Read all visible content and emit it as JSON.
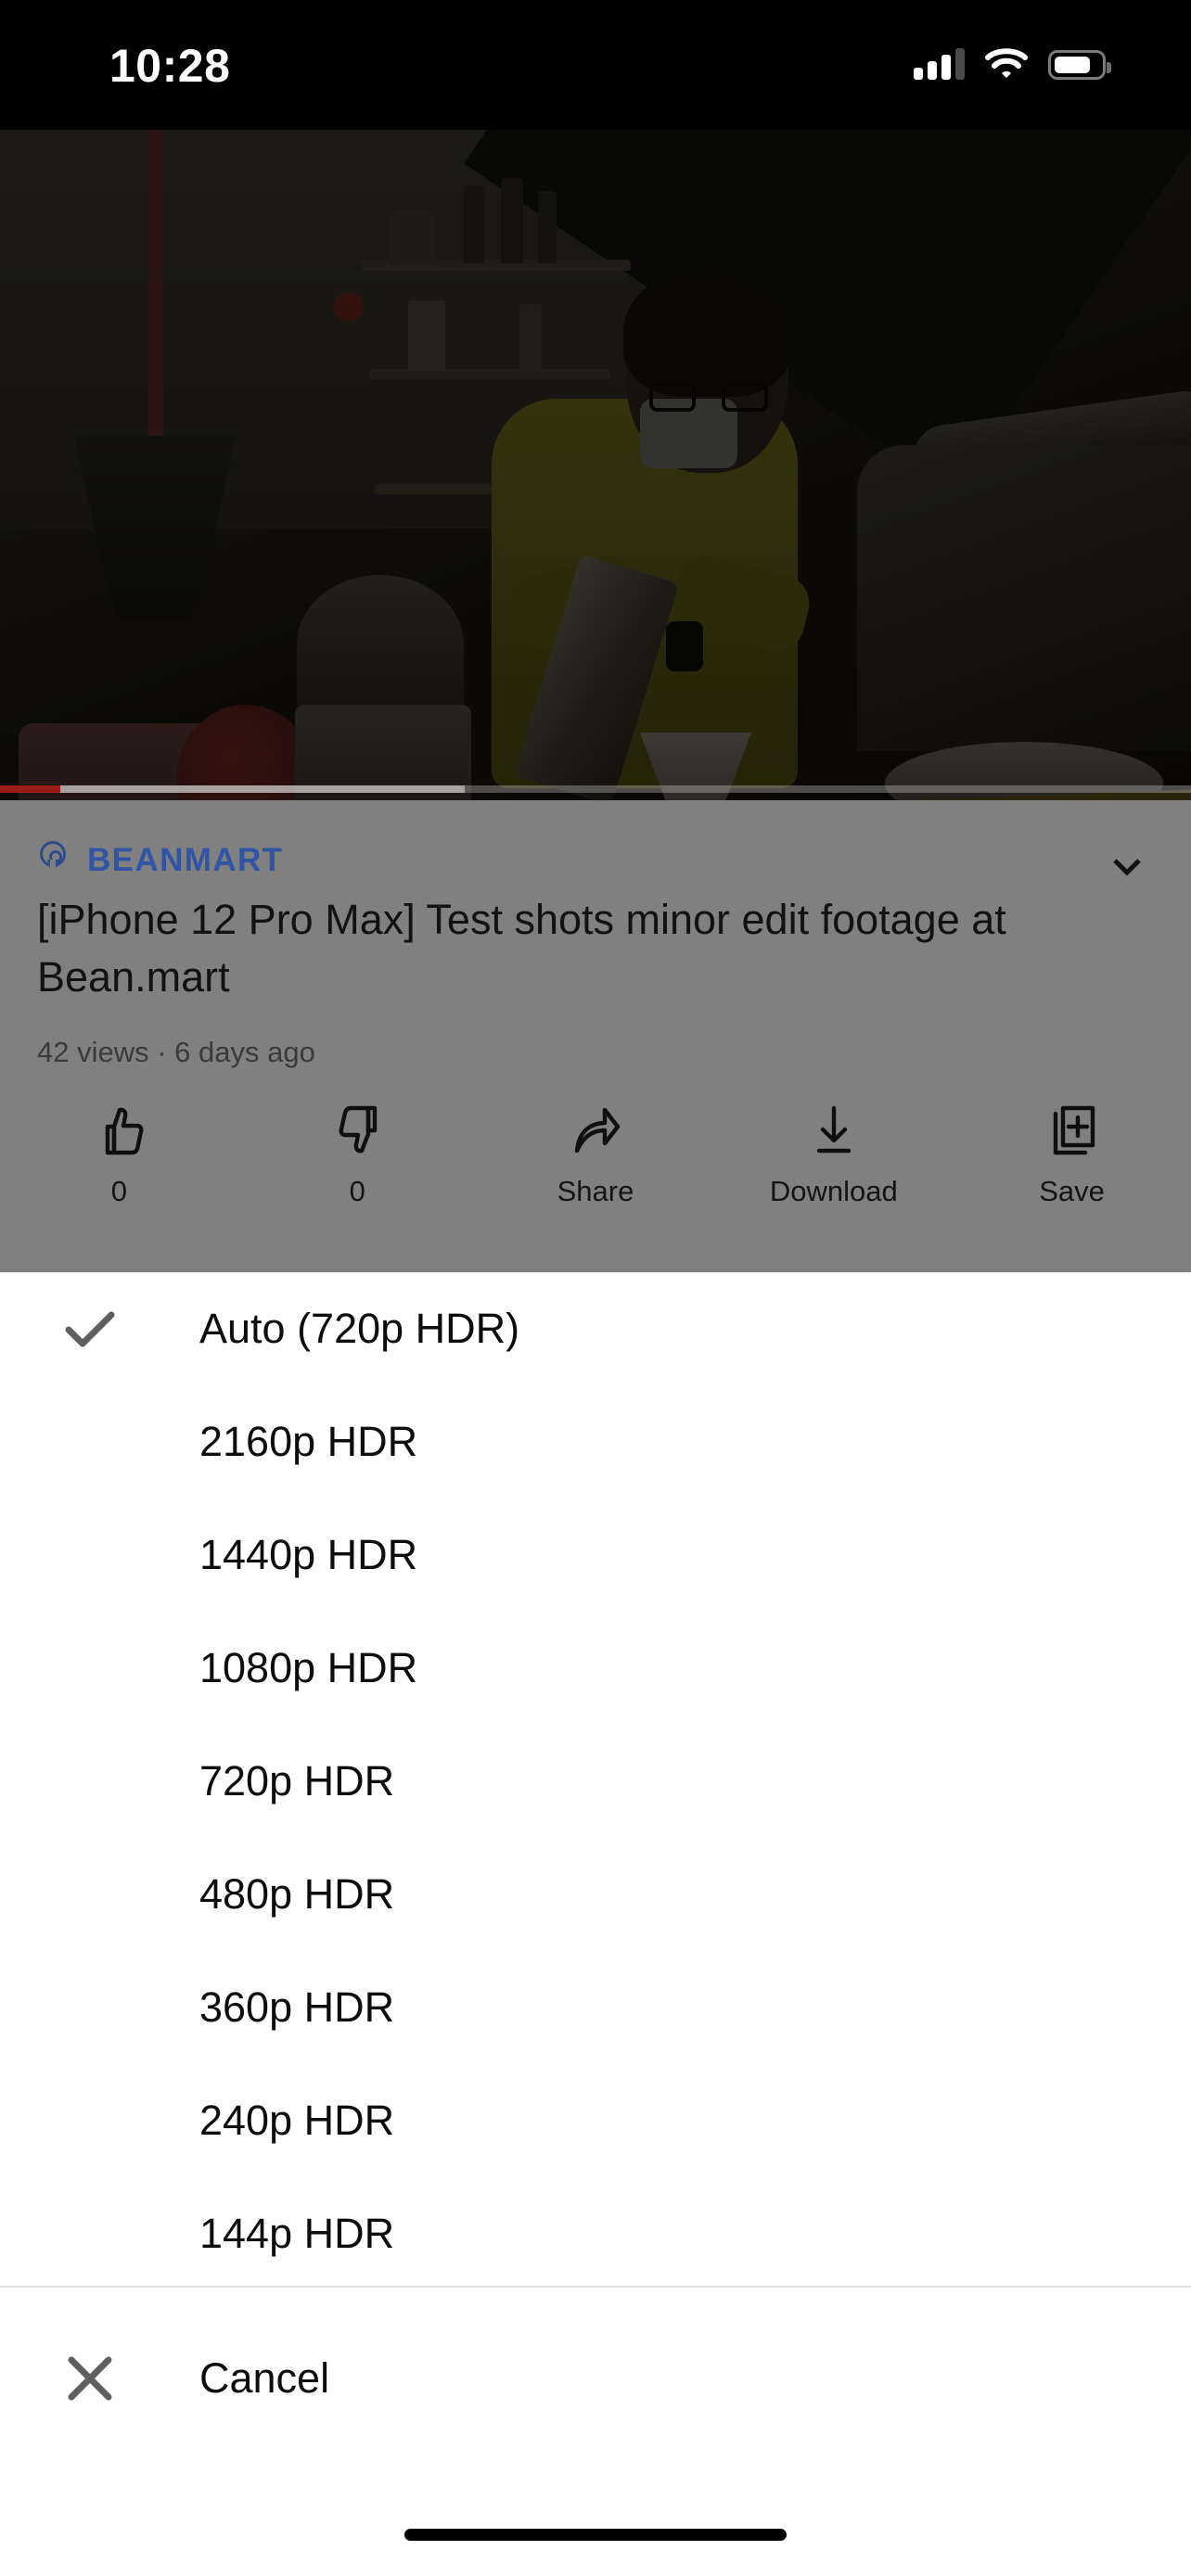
{
  "status_bar": {
    "time": "10:28",
    "signal_icon": "cellular-signal-icon",
    "wifi_icon": "wifi-icon",
    "battery_icon": "battery-icon",
    "battery_level_percent": 68
  },
  "player": {
    "thumbnail_description": "Barista in yellow shirt with glasses and face mask pouring from a glass carafe in a coffee shop",
    "progress_played_percent": 5.1,
    "progress_buffered_percent": 39,
    "progress_color": "#9b1b16",
    "dimmed": true
  },
  "video_meta": {
    "location_icon": "location-pin-icon",
    "channel": "BEANMART",
    "channel_color": "#2f55a4",
    "expand_icon": "chevron-down-icon",
    "title": "[iPhone 12 Pro Max] Test shots minor edit footage at Bean.mart",
    "stats": "42 views · 6 days ago",
    "actions": [
      {
        "icon": "thumbs-up-icon",
        "label": "0"
      },
      {
        "icon": "thumbs-down-icon",
        "label": "0"
      },
      {
        "icon": "share-icon",
        "label": "Share"
      },
      {
        "icon": "download-icon",
        "label": "Download"
      },
      {
        "icon": "save-to-playlist-icon",
        "label": "Save"
      }
    ]
  },
  "quality_sheet": {
    "options": [
      {
        "label": "Auto (720p HDR)",
        "selected": true
      },
      {
        "label": "2160p HDR",
        "selected": false
      },
      {
        "label": "1440p HDR",
        "selected": false
      },
      {
        "label": "1080p HDR",
        "selected": false
      },
      {
        "label": "720p HDR",
        "selected": false
      },
      {
        "label": "480p HDR",
        "selected": false
      },
      {
        "label": "360p HDR",
        "selected": false
      },
      {
        "label": "240p HDR",
        "selected": false
      },
      {
        "label": "144p HDR",
        "selected": false
      }
    ],
    "check_icon": "checkmark-icon",
    "cancel": {
      "icon": "close-x-icon",
      "label": "Cancel"
    }
  },
  "home_indicator": "home-indicator"
}
